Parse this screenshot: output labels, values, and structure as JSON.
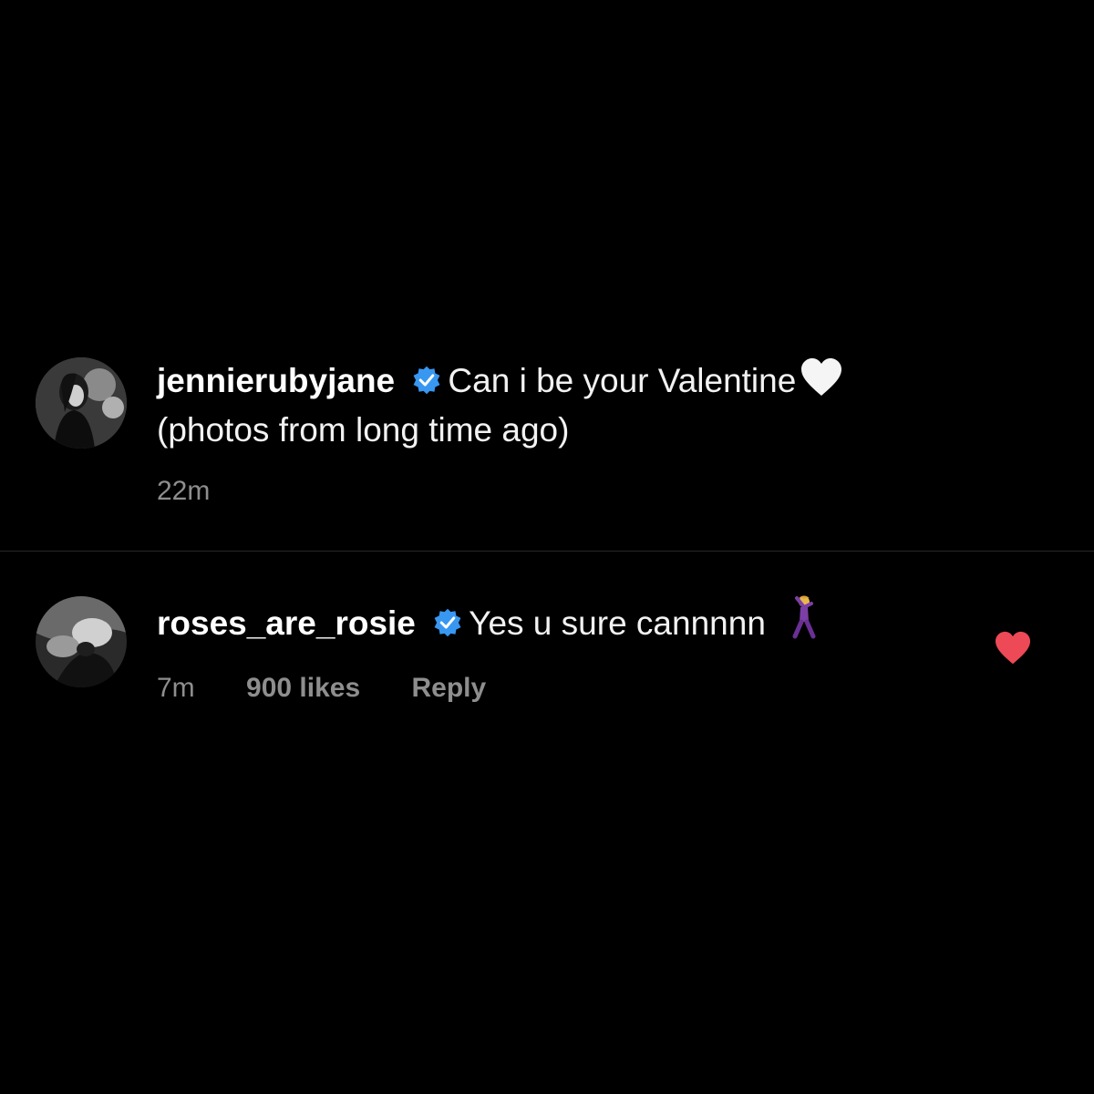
{
  "comments": [
    {
      "username": "jennierubyjane",
      "verified": true,
      "text_line1": "Can i be your Valentine",
      "emoji": "white-heart-icon",
      "text_line2": "(photos from long time ago)",
      "time": "22m"
    },
    {
      "username": "roses_are_rosie",
      "verified": true,
      "text_line1": "Yes u sure cannnnn",
      "emoji": "dancing-person-icon",
      "time": "7m",
      "likes": "900 likes",
      "reply_label": "Reply",
      "liked": true
    }
  ],
  "colors": {
    "background": "#000000",
    "verified_blue": "#3897f0",
    "like_red": "#ed4956",
    "secondary_text": "#8e8e8e"
  }
}
